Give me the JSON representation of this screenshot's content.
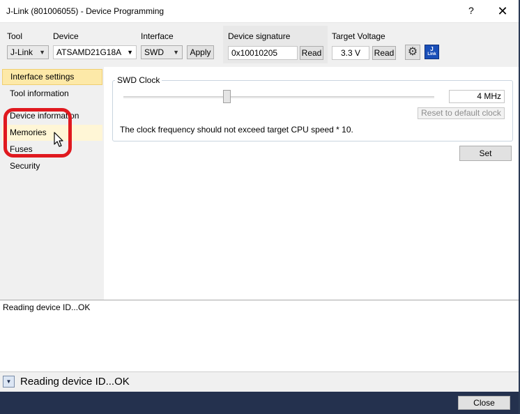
{
  "window": {
    "title": "J-Link (801006055) - Device Programming",
    "help_symbol": "?",
    "close_symbol": "✕"
  },
  "toolbar": {
    "tool_label": "Tool",
    "tool_value": "J-Link",
    "device_label": "Device",
    "device_value": "ATSAMD21G18A",
    "interface_label": "Interface",
    "interface_value": "SWD",
    "apply_label": "Apply",
    "signature_label": "Device signature",
    "signature_value": "0x10010205",
    "signature_read_label": "Read",
    "voltage_label": "Target Voltage",
    "voltage_value": "3.3 V",
    "voltage_read_label": "Read",
    "settings_icon": "gear-icon",
    "jlink_icon": "jlink-logo-icon",
    "jlink_text_top": "J",
    "jlink_text_bottom": "Link"
  },
  "nav": {
    "items": [
      {
        "label": "Interface settings",
        "state": "selected"
      },
      {
        "label": "Tool information",
        "state": "normal"
      },
      {
        "label": "Device information",
        "state": "normal"
      },
      {
        "label": "Memories",
        "state": "hover"
      },
      {
        "label": "Fuses",
        "state": "normal"
      },
      {
        "label": "Security",
        "state": "normal"
      }
    ]
  },
  "swd": {
    "group_title": "SWD Clock",
    "frequency": "4 MHz",
    "reset_label": "Reset to default clock",
    "note": "The clock frequency should not exceed target CPU speed * 10.",
    "set_label": "Set"
  },
  "log": {
    "text": "Reading device ID...OK"
  },
  "status": {
    "text": "Reading device ID...OK",
    "toggle_icon": "chevron-down-icon"
  },
  "footer": {
    "close_label": "Close"
  },
  "colors": {
    "annotation": "#e0191f",
    "selected_nav": "#fde9a8",
    "bottom_bar": "#24314e"
  }
}
